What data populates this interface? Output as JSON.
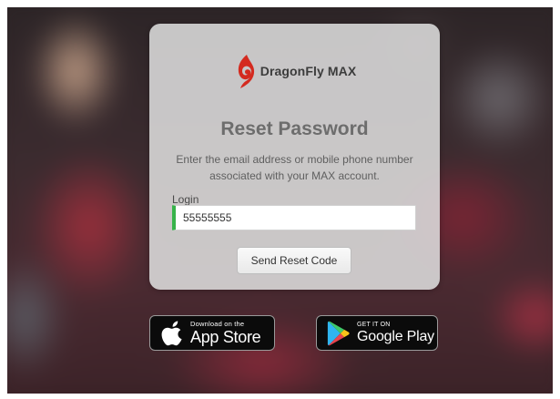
{
  "brand": {
    "name": "DragonFly MAX",
    "logo_icon": "dragonfly-flame-logo",
    "logo_color": "#d42a1f"
  },
  "reset": {
    "title": "Reset Password",
    "description": "Enter the email address or mobile phone number associated with your MAX account.",
    "login_label": "Login",
    "login_value": "55555555",
    "send_button": "Send Reset Code",
    "input_accent": "#37b34a"
  },
  "stores": {
    "apple": {
      "small_text": "Download on the",
      "big_text": "App Store",
      "icon": "apple-icon"
    },
    "google": {
      "small_text": "GET IT ON",
      "big_text": "Google Play",
      "icon": "google-play-icon"
    }
  }
}
